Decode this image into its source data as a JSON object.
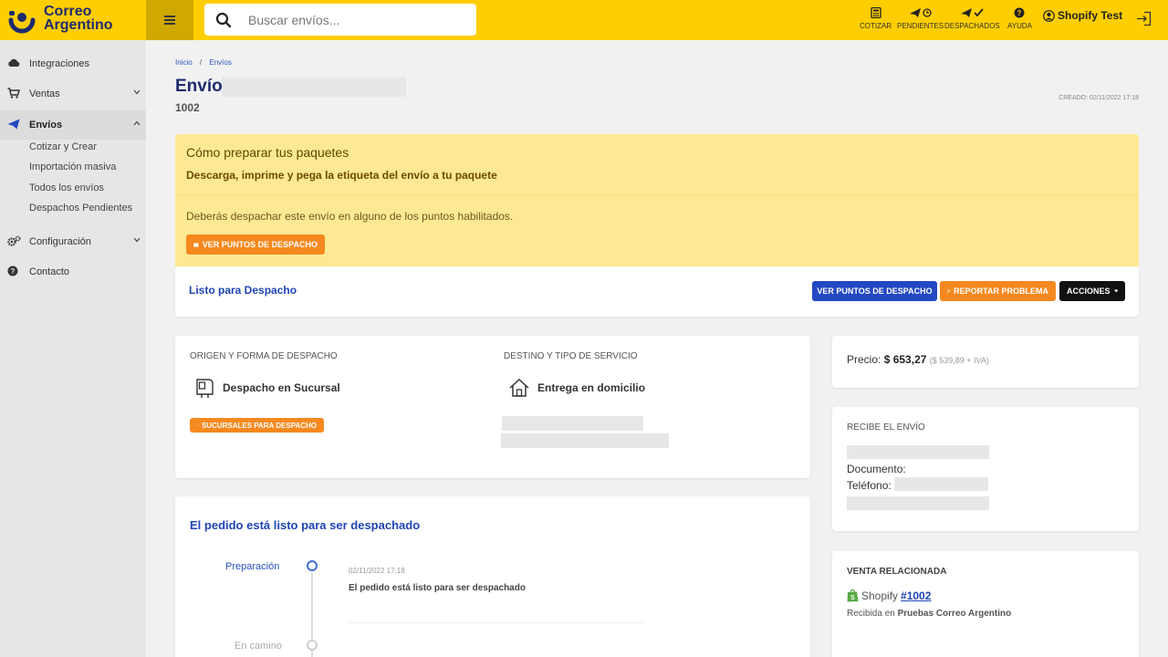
{
  "header": {
    "brand_line1": "Correo",
    "brand_line2": "Argentino",
    "search_placeholder": "Buscar envíos...",
    "nav": [
      {
        "label": "COTIZAR",
        "icon": "calculator-icon"
      },
      {
        "label": "PENDIENTES",
        "icon": "plane-clock-icon"
      },
      {
        "label": "DESPACHADOS",
        "icon": "plane-check-icon"
      },
      {
        "label": "AYUDA",
        "icon": "help-icon"
      }
    ],
    "user": "Shopify Test"
  },
  "sidebar": {
    "items": [
      {
        "label": "Integraciones",
        "icon": "cloud-icon"
      },
      {
        "label": "Ventas",
        "icon": "cart-icon"
      },
      {
        "label": "Envíos",
        "icon": "send-icon"
      },
      {
        "label": "Configuración",
        "icon": "gears-icon"
      },
      {
        "label": "Contacto",
        "icon": "help-icon"
      }
    ],
    "envios_sub": [
      "Cotizar y Crear",
      "Importación masiva",
      "Todos los envíos",
      "Despachos Pendientes"
    ]
  },
  "main": {
    "breadcrumb": {
      "home": "Inicio",
      "separator": "/",
      "current": "Envíos"
    },
    "title": "Envío",
    "order_id": "1002",
    "created": "CREADO: 02/11/2022 17:18",
    "banner": {
      "title": "Cómo preparar tus paquetes",
      "subtitle": "Descarga, imprime y pega la etiqueta del envío a tu paquete",
      "text": "Deberás despachar este envío en alguno de los puntos habilitados.",
      "button": "VER PUNTOS DE DESPACHO"
    },
    "status": {
      "label": "Listo para Despacho",
      "btn_points": "VER PUNTOS DE DESPACHO",
      "btn_report": "REPORTAR PROBLEMA",
      "btn_actions": "ACCIONES"
    },
    "origin": {
      "heading": "ORIGEN Y FORMA DE DESPACHO",
      "method": "Despacho en Sucursal",
      "button": "SUCURSALES PARA DESPACHO"
    },
    "destination": {
      "heading": "DESTINO Y TIPO DE SERVICIO",
      "method": "Entrega en domicilio"
    },
    "timeline": {
      "title": "El pedido está listo para ser despachado",
      "steps": [
        {
          "label": "Preparación",
          "date": "02/11/2022 17:18",
          "desc": "El pedido está listo para ser despachado"
        },
        {
          "label": "En camino"
        }
      ]
    },
    "price": {
      "label": "Precio:",
      "value": "$ 653,27",
      "detail": "($ 539,89 + IVA)"
    },
    "receiver": {
      "heading": "RECIBE EL ENVÍO",
      "documento": "Documento:",
      "telefono": "Teléfono:"
    },
    "sale": {
      "heading": "VENTA RELACIONADA",
      "platform": "Shopify",
      "order_link": "#1002",
      "received_prefix": "Recibida en",
      "store": "Pruebas Correo Argentino"
    }
  },
  "colors": {
    "brand_yellow": "#ffce00",
    "brand_navy": "#1e2b6e",
    "accent_blue": "#2348c2",
    "accent_orange": "#f5891f"
  }
}
